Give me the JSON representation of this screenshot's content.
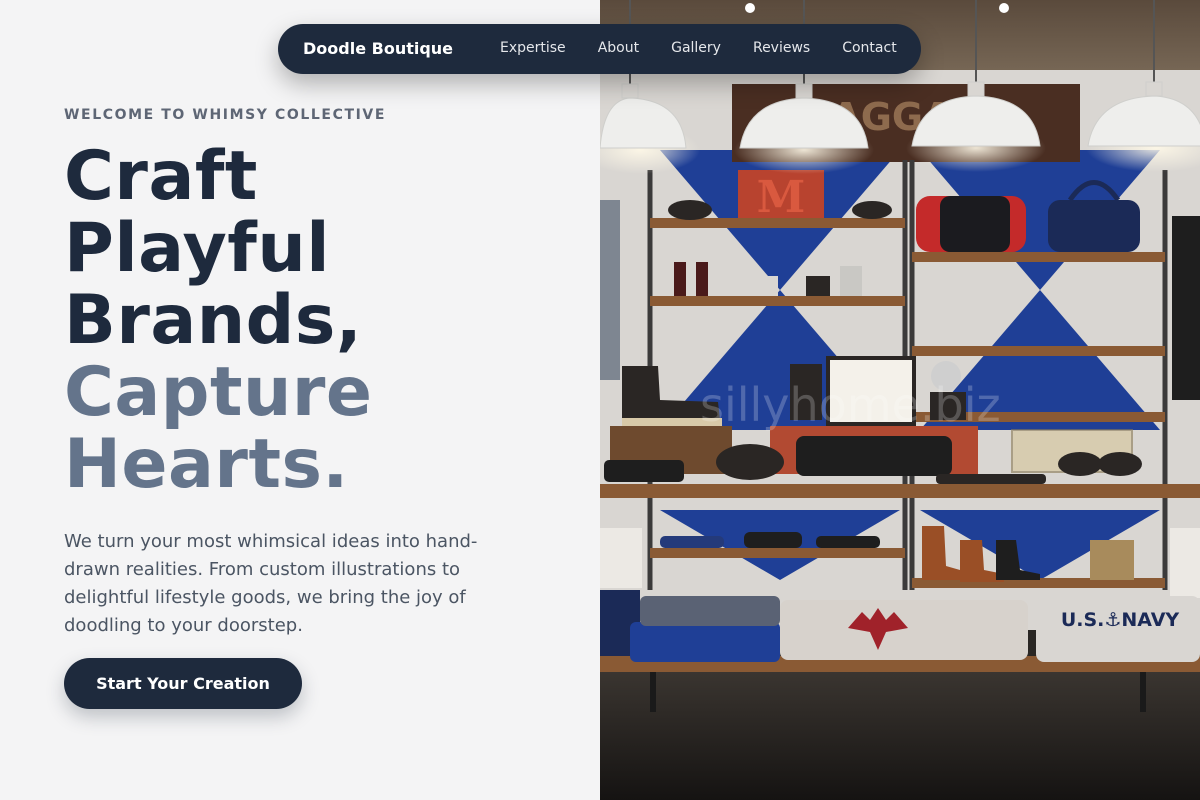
{
  "nav": {
    "brand": "Doodle Boutique",
    "links": [
      "Expertise",
      "About",
      "Gallery",
      "Reviews",
      "Contact"
    ]
  },
  "hero": {
    "eyebrow": "WELCOME TO WHIMSY COLLECTIVE",
    "headline_lines": [
      "Craft",
      "Playful",
      "Brands,"
    ],
    "headline_accent_lines": [
      "Capture",
      "Hearts."
    ],
    "intro": "We turn your most whimsical ideas into hand-drawn realities. From custom illustrations to delightful lifestyle goods, we bring the joy of doodling to your doorstep.",
    "cta_label": "Start Your Creation"
  },
  "photo": {
    "sign_text": "BAGGAGE",
    "letter_block": "M",
    "shirt_text": "U.S.⚓NAVY",
    "watermark": "sillyhome.biz"
  },
  "colors": {
    "ink": "#1e2a3d",
    "accent_slate": "#64748b",
    "background": "#f4f4f5",
    "blue_wall": "#1f3f96",
    "wood": "#8a5a34"
  }
}
